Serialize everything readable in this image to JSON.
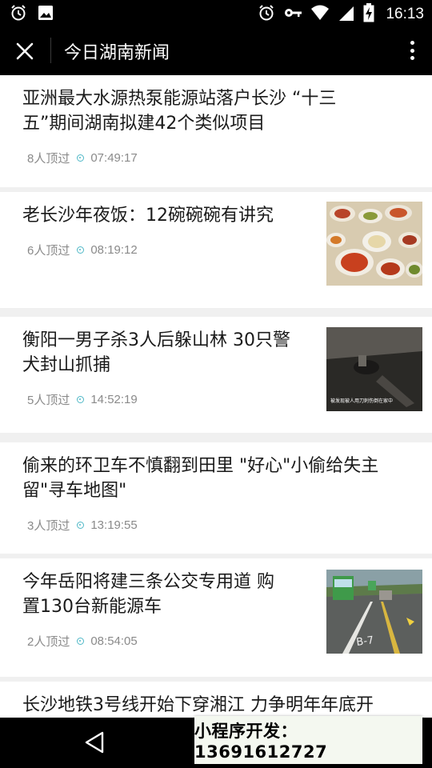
{
  "status_bar": {
    "time": "16:13",
    "left_icons": [
      "alarm-icon",
      "image-icon"
    ],
    "right_icons": [
      "alarm-icon",
      "key-icon",
      "wifi-icon",
      "signal-icon",
      "battery-charging-icon"
    ]
  },
  "title_bar": {
    "title": "今日湖南新闻",
    "close_icon": "close-icon",
    "more_icon": "more-vertical-icon"
  },
  "articles": [
    {
      "title": "亚洲最大水源热泵能源站落户长沙 “十三五”期间湖南拟建42个类似项目",
      "line1": "亚洲最大水源热泵能源站落户长沙 “十三",
      "line2": "五”期间湖南拟建42个类似项目",
      "readers": "8人顶过",
      "time": "07:49:17",
      "has_thumb": false
    },
    {
      "title": "老长沙年夜饭：12碗碗碗有讲究",
      "line1": "老长沙年夜饭：12碗碗碗有讲究",
      "line2": "",
      "readers": "6人顶过",
      "time": "08:19:12",
      "has_thumb": true
    },
    {
      "title": "衡阳一男子杀3人后躲山林 30只警犬封山抓捕",
      "line1": "衡阳一男子杀3人后躲山林 30只警",
      "line2": "犬封山抓捕",
      "readers": "5人顶过",
      "time": "14:52:19",
      "has_thumb": true,
      "thumb_caption": "被发现被人用刀刺伤倒在家中"
    },
    {
      "title": "偷来的环卫车不慎翻到田里 \"好心\"小偷给失主留\"寻车地图\"",
      "line1": "偷来的环卫车不慎翻到田里 \"好心\"小偷给失主",
      "line2": "留\"寻车地图\"",
      "readers": "3人顶过",
      "time": "13:19:55",
      "has_thumb": false
    },
    {
      "title": "今年岳阳将建三条公交专用道 购置130台新能源车",
      "line1": "今年岳阳将建三条公交专用道 购",
      "line2": "置130台新能源车",
      "readers": "2人顶过",
      "time": "08:54:05",
      "has_thumb": true
    },
    {
      "title": "长沙地铁3号线开始下穿湘江 力争明年年底开",
      "line1": "长沙地铁3号线开始下穿湘江 力争明年年底开",
      "line2": "",
      "readers": "",
      "time": "",
      "has_thumb": false
    }
  ],
  "promo_banner": "小程序开发：13691612727",
  "nav_bar": {
    "back_icon": "back-triangle-icon"
  },
  "colors": {
    "accent": "#4fb8c7",
    "bar": "#000000",
    "card": "#ffffff",
    "separator": "#f0f0f0"
  }
}
